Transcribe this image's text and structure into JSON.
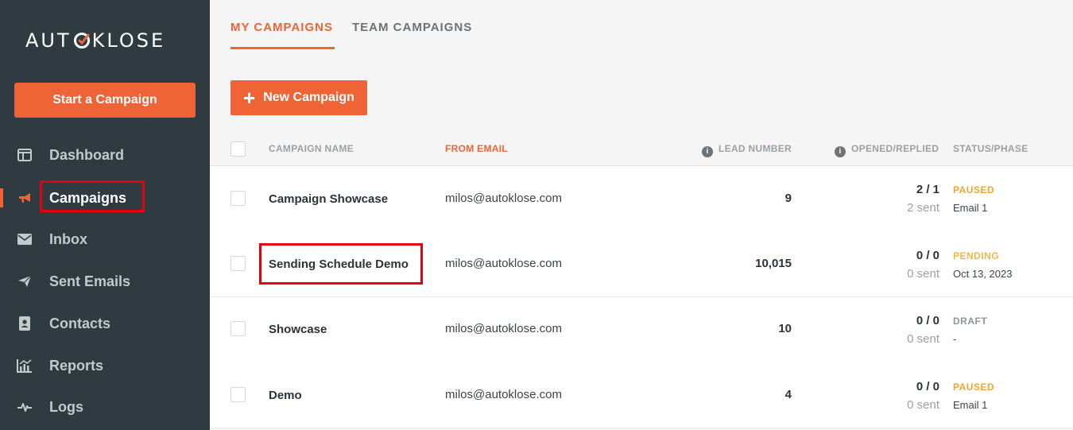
{
  "sidebar": {
    "logo": {
      "left": "AUT",
      "right": "KLOSE"
    },
    "start_button": "Start a Campaign",
    "items": [
      {
        "label": "Dashboard",
        "icon": "dashboard-icon"
      },
      {
        "label": "Campaigns",
        "icon": "megaphone-icon"
      },
      {
        "label": "Inbox",
        "icon": "envelope-icon"
      },
      {
        "label": "Sent Emails",
        "icon": "paper-plane-icon"
      },
      {
        "label": "Contacts",
        "icon": "contact-card-icon"
      },
      {
        "label": "Reports",
        "icon": "reports-chart-icon"
      },
      {
        "label": "Logs",
        "icon": "pulse-icon"
      }
    ]
  },
  "tabs": {
    "my": "MY CAMPAIGNS",
    "team": "TEAM CAMPAIGNS"
  },
  "new_campaign_button": "New Campaign",
  "table": {
    "headers": {
      "name": "CAMPAIGN NAME",
      "from_email": "FROM EMAIL",
      "lead_number": "LEAD NUMBER",
      "opened_replied": "OPENED/REPLIED",
      "status_phase": "STATUS/PHASE"
    },
    "rows": [
      {
        "name": "Campaign Showcase",
        "email": "milos@autoklose.com",
        "leads": "9",
        "opened_replied": "2 / 1",
        "sent": "2 sent",
        "status": "PAUSED",
        "phase": "Email 1"
      },
      {
        "name": "Sending Schedule Demo",
        "email": "milos@autoklose.com",
        "leads": "10,015",
        "opened_replied": "0 / 0",
        "sent": "0 sent",
        "status": "PENDING",
        "phase": "Oct 13, 2023"
      },
      {
        "name": "Showcase",
        "email": "milos@autoklose.com",
        "leads": "10",
        "opened_replied": "0 / 0",
        "sent": "0 sent",
        "status": "DRAFT",
        "phase": "-"
      },
      {
        "name": "Demo",
        "email": "milos@autoklose.com",
        "leads": "4",
        "opened_replied": "0 / 0",
        "sent": "0 sent",
        "status": "PAUSED",
        "phase": "Email 1"
      }
    ]
  },
  "colors": {
    "accent": "#ee6436",
    "sidebar_bg": "#2f3b40",
    "status_paused": "#f0a531",
    "status_pending": "#f0b64a",
    "status_draft": "#8e9498",
    "highlight": "#e3000f"
  }
}
